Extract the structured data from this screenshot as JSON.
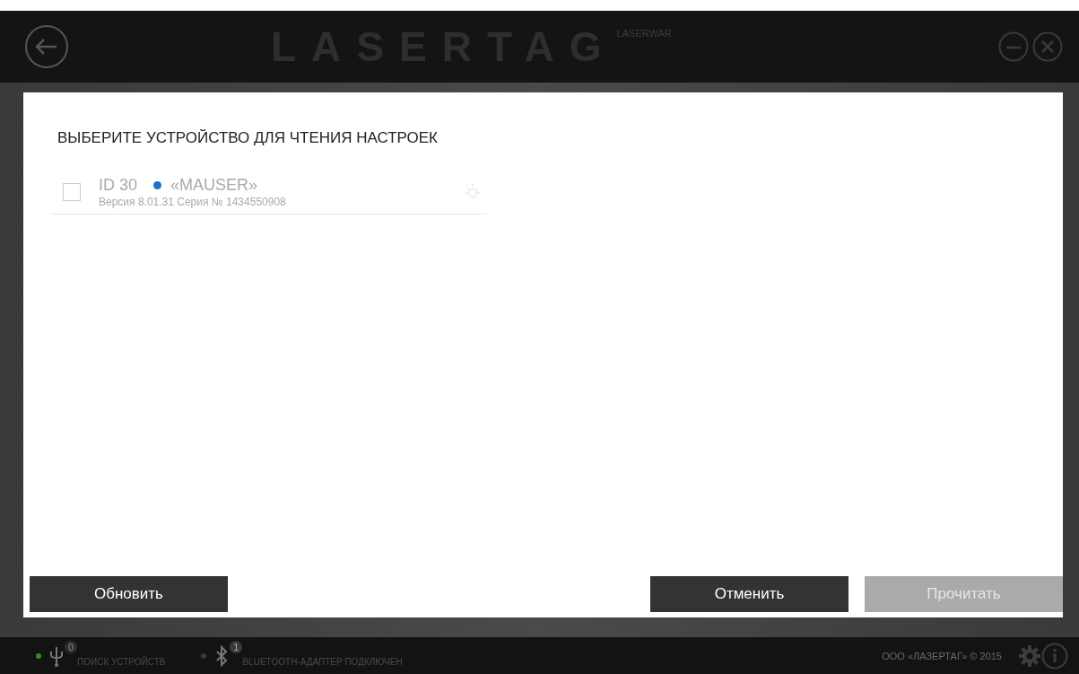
{
  "header": {
    "logo": "LASERTAG",
    "brand": "LASERWAR"
  },
  "dialog": {
    "title": "ВЫБЕРИТЕ УСТРОЙСТВО ДЛЯ ЧТЕНИЯ НАСТРОЕК",
    "devices": [
      {
        "id": "ID 30",
        "color": "#1a73c6",
        "name": "«MAUSER»",
        "details": "Версия 8.01.31 Серия № 1434550908",
        "checked": false
      }
    ],
    "left_buttons": [
      {
        "label": "Обновить",
        "disabled": false
      }
    ],
    "right_buttons": [
      {
        "label": "Отменить",
        "disabled": false
      },
      {
        "label": "Прочитать",
        "disabled": true
      }
    ]
  },
  "status_bar": {
    "items": [
      {
        "kind": "usb",
        "color": "#3d8a2e",
        "count": "0",
        "label": "ПОИСК УСТРОЙСТВ"
      },
      {
        "kind": "bluetooth",
        "color": "#3a3a3a",
        "count": "1",
        "label": "BLUETOOTH-АДАПТЕР ПОДКЛЮЧЕН"
      }
    ],
    "copyright": "ООО «ЛАЗЕРТАГ» © 2015"
  }
}
